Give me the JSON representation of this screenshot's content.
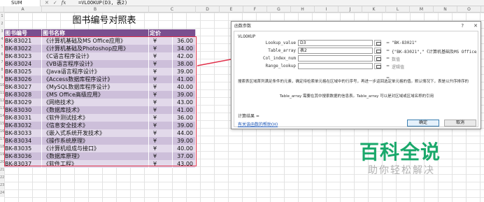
{
  "formula_bar": {
    "name_box": "SUM",
    "formula": "=VLOOKUP(D3, 表2)"
  },
  "columns": [
    "A",
    "B",
    "C",
    "D",
    "E",
    "F",
    "G",
    "H",
    "I",
    "J",
    "K",
    "L",
    "M",
    "N",
    "O"
  ],
  "rows": [
    "1",
    "2",
    "3",
    "4",
    "5",
    "6",
    "7",
    "8",
    "9",
    "10",
    "11",
    "12",
    "13",
    "14",
    "15",
    "16",
    "17",
    "18",
    "19",
    "20",
    "21",
    "22",
    "23",
    "24"
  ],
  "sheet": {
    "title": "图书编号对照表",
    "headers": {
      "code": "图书编号",
      "name": "图书名称",
      "price": "定价"
    },
    "currency": "¥",
    "books": [
      {
        "code": "BK-83021",
        "name": "《计算机基础及MS Office应用》",
        "price": "36.00"
      },
      {
        "code": "BK-83022",
        "name": "《计算机基础及Photoshop应用》",
        "price": "34.00"
      },
      {
        "code": "BK-83023",
        "name": "《C语言程序设计》",
        "price": "42.00"
      },
      {
        "code": "BK-83024",
        "name": "《VB语言程序设计》",
        "price": "38.00"
      },
      {
        "code": "BK-83025",
        "name": "《Java语言程序设计》",
        "price": "39.00"
      },
      {
        "code": "BK-83026",
        "name": "《Access数据库程序设计》",
        "price": "41.00"
      },
      {
        "code": "BK-83027",
        "name": "《MySQL数据库程序设计》",
        "price": "40.00"
      },
      {
        "code": "BK-83028",
        "name": "《MS Office高级应用》",
        "price": "39.00"
      },
      {
        "code": "BK-83029",
        "name": "《网络技术》",
        "price": "43.00"
      },
      {
        "code": "BK-83030",
        "name": "《数据库技术》",
        "price": "41.00"
      },
      {
        "code": "BK-83031",
        "name": "《软件测试技术》",
        "price": "36.00"
      },
      {
        "code": "BK-83032",
        "name": "《信息安全技术》",
        "price": "39.00"
      },
      {
        "code": "BK-83033",
        "name": "《嵌入式系统开发技术》",
        "price": "44.00"
      },
      {
        "code": "BK-83034",
        "name": "《操作系统原理》",
        "price": "39.00"
      },
      {
        "code": "BK-83035",
        "name": "《计算机组成与接口》",
        "price": "40.00"
      },
      {
        "code": "BK-83036",
        "name": "《数据库原理》",
        "price": "37.00"
      },
      {
        "code": "BK-83037",
        "name": "《软件工程》",
        "price": "43.00"
      }
    ]
  },
  "dialog": {
    "title": "函数参数",
    "help": "?",
    "close": "✕",
    "function_name": "VLOOKUP",
    "args": [
      {
        "label": "Lookup_value",
        "input": "D3",
        "value": "\"BK-83021\""
      },
      {
        "label": "Table_array",
        "input": "表2",
        "value": "{\"BK-83021\",\"《计算机基础及MS Office应"
      },
      {
        "label": "Col_index_num",
        "input": "",
        "value": "数值"
      },
      {
        "label": "Range_lookup",
        "input": "",
        "value": "逻辑值"
      }
    ],
    "equals": "=",
    "description": "搜索表区域首列满足条件的元素，确定待检索单元格在区域中的行序号，再进一步返回选定单元格的值。默认情况下，表是以升序排序的",
    "arg_description": "Table_array  需要在其中搜索数据的信息表。Table_array 可以是对区域或区域名称的引用",
    "calc_result": "计算结果 =",
    "help_link": "有关该函数的帮助(H)",
    "ok": "确定",
    "cancel": "取消"
  },
  "watermark": {
    "brand": "百科全说",
    "slogan": "助你轻松解决"
  },
  "colors": {
    "header_bg": "#7a4f8f",
    "row_light": "#e2d9ea",
    "row_dark": "#cdbfda",
    "selection": "#e0304a",
    "watermark": "#1aa86b"
  }
}
